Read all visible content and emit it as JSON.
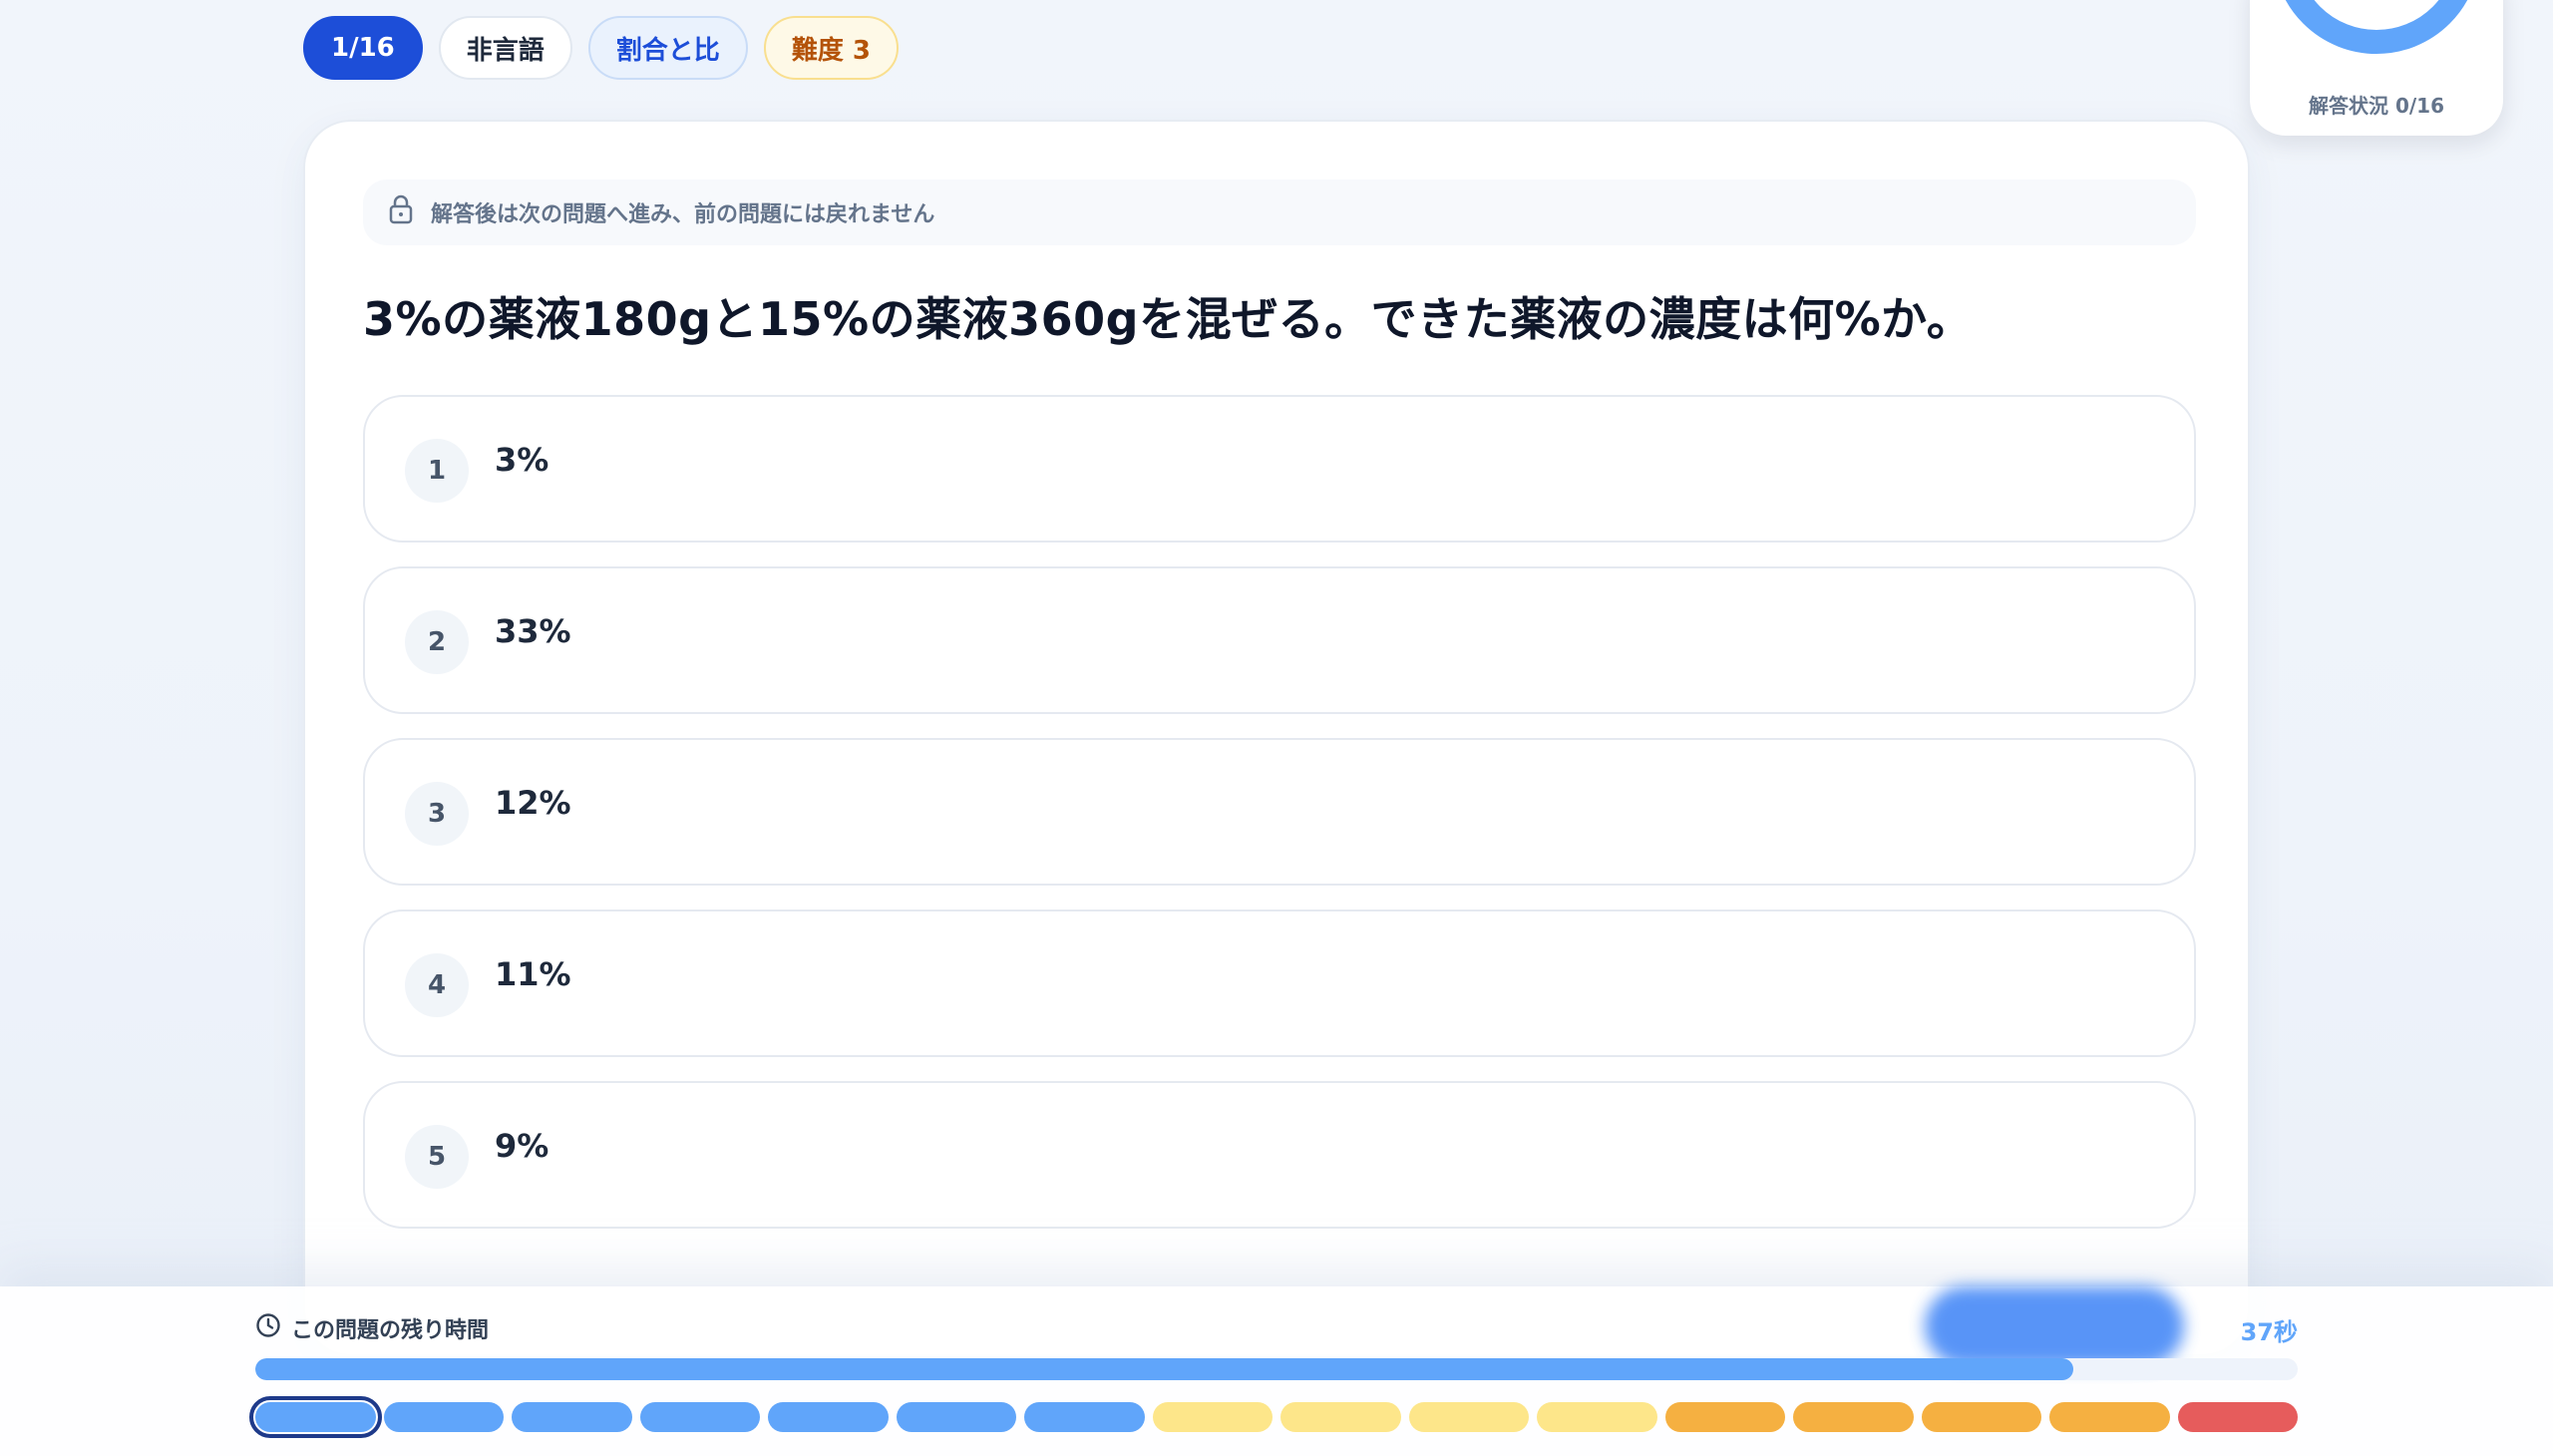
{
  "tags": {
    "count": "1/16",
    "type": "非言語",
    "category": "割合と比",
    "difficulty": "難度 3"
  },
  "status": {
    "label": "解答状況 0/16",
    "answered": 0,
    "total": 16,
    "ring_color": "#60a5fa"
  },
  "notice": {
    "icon": "lock-icon",
    "text": "解答後は次の問題へ進み、前の問題には戻れません"
  },
  "question": "3%の薬液180gと15%の薬液360gを混ぜる。できた薬液の濃度は何%か。",
  "options": [
    {
      "num": "1",
      "text": "3%"
    },
    {
      "num": "2",
      "text": "33%"
    },
    {
      "num": "3",
      "text": "12%"
    },
    {
      "num": "4",
      "text": "11%"
    },
    {
      "num": "5",
      "text": "9%"
    }
  ],
  "timer": {
    "icon": "clock-icon",
    "label": "この問題の残り時間",
    "seconds": "37秒",
    "progress": 0.89
  },
  "segments": [
    {
      "color": "#60a5fa",
      "current": true
    },
    {
      "color": "#60a5fa"
    },
    {
      "color": "#60a5fa"
    },
    {
      "color": "#60a5fa"
    },
    {
      "color": "#60a5fa"
    },
    {
      "color": "#60a5fa"
    },
    {
      "color": "#60a5fa"
    },
    {
      "color": "#fde68a"
    },
    {
      "color": "#fde68a"
    },
    {
      "color": "#fde68a"
    },
    {
      "color": "#fde68a"
    },
    {
      "color": "#f5b041"
    },
    {
      "color": "#f5b041"
    },
    {
      "color": "#f5b041"
    },
    {
      "color": "#f5b041"
    },
    {
      "color": "#e65c5c"
    }
  ]
}
